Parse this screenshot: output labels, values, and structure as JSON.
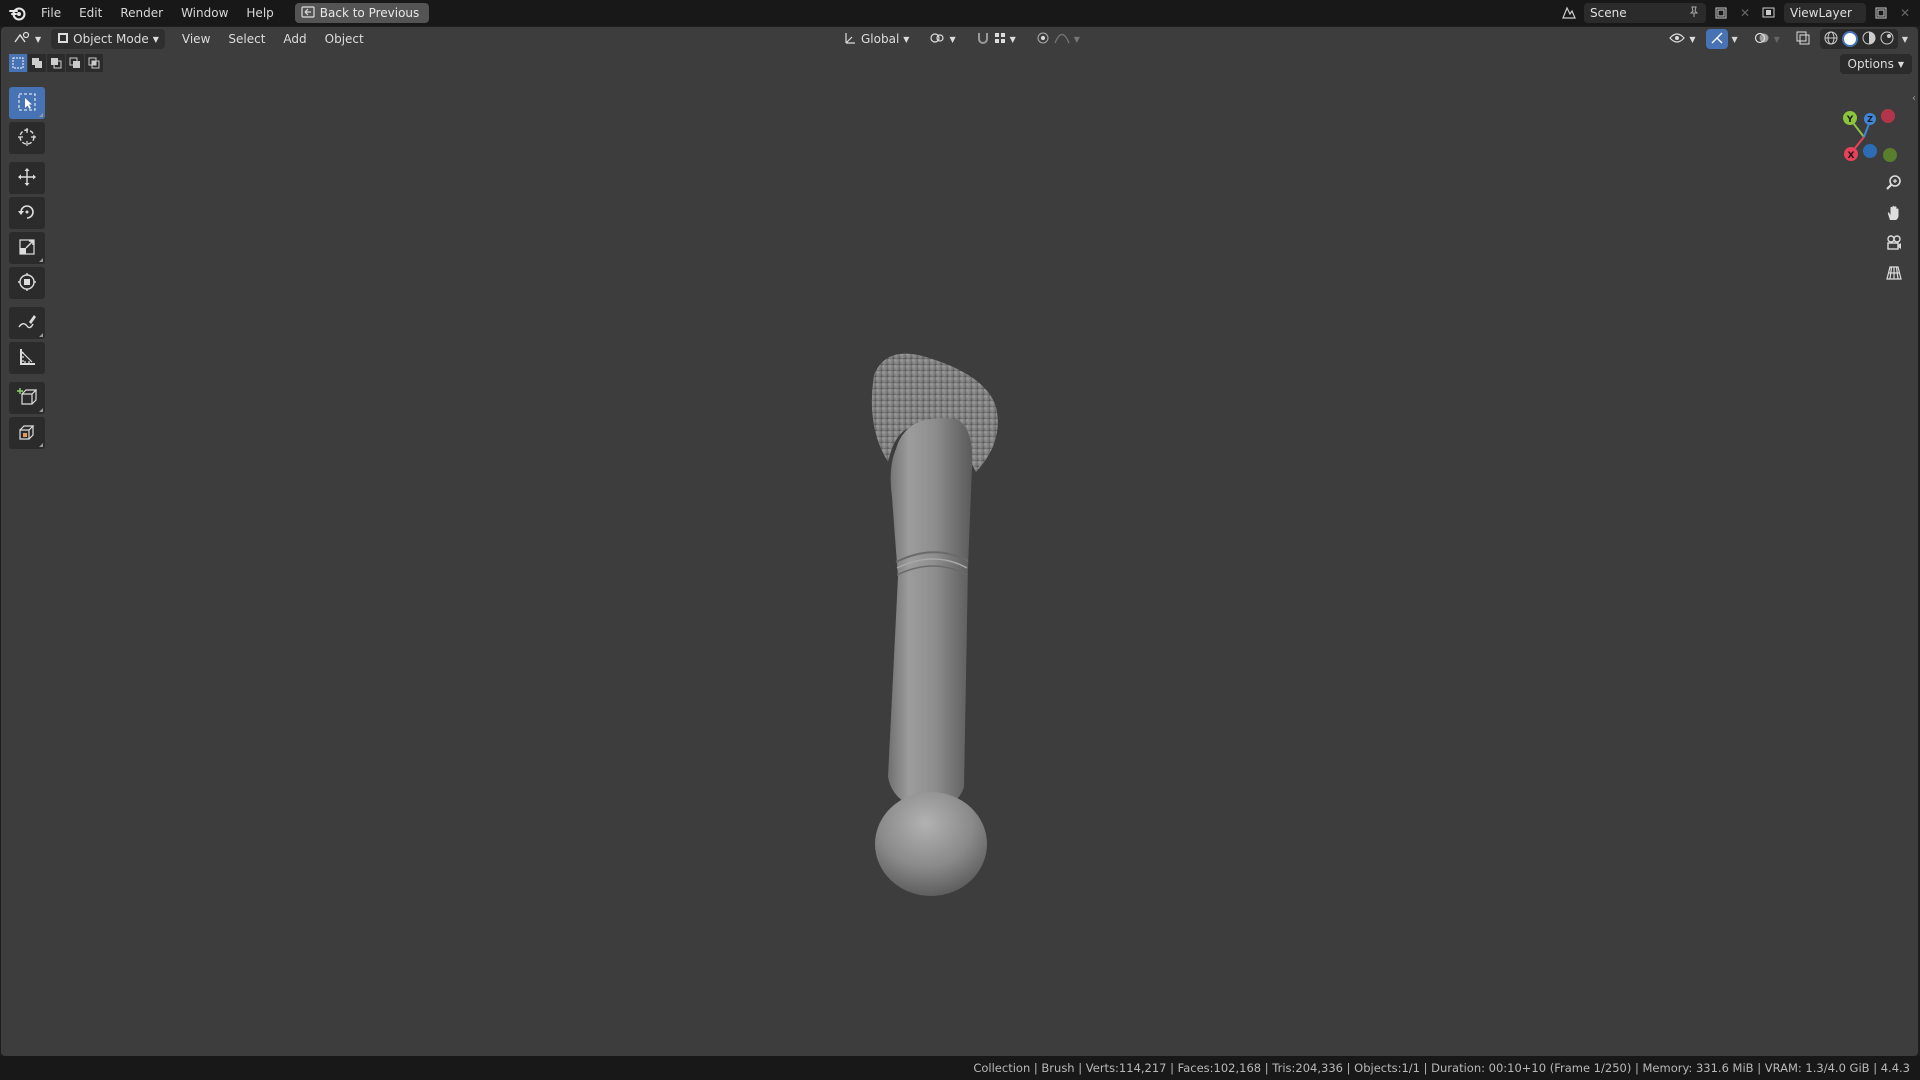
{
  "menu": {
    "file": "File",
    "edit": "Edit",
    "render": "Render",
    "window": "Window",
    "help": "Help",
    "back_to_previous": "Back to Previous"
  },
  "top_right": {
    "scene": "Scene",
    "view_layer": "ViewLayer"
  },
  "header": {
    "mode": "Object Mode",
    "view": "View",
    "select": "Select",
    "add": "Add",
    "object": "Object",
    "transform_orientation": "Global",
    "options": "Options"
  },
  "gizmo": {
    "x_label": "X",
    "y_label": "Y",
    "z_label": "Z",
    "x_color": "#e8415a",
    "y_color": "#8cc43c",
    "z_color": "#3d86d8"
  },
  "status": {
    "text": "Collection | Brush | Verts:114,217 | Faces:102,168 | Tris:204,336 | Objects:1/1 | Duration: 00:10+10 (Frame 1/250) | Memory: 331.6 MiB | VRAM: 1.3/4.0 GiB | 4.4.3"
  },
  "colors": {
    "accent": "#4772b3",
    "viewport_bg": "#3d3d3d",
    "bar_bg": "#181818"
  }
}
